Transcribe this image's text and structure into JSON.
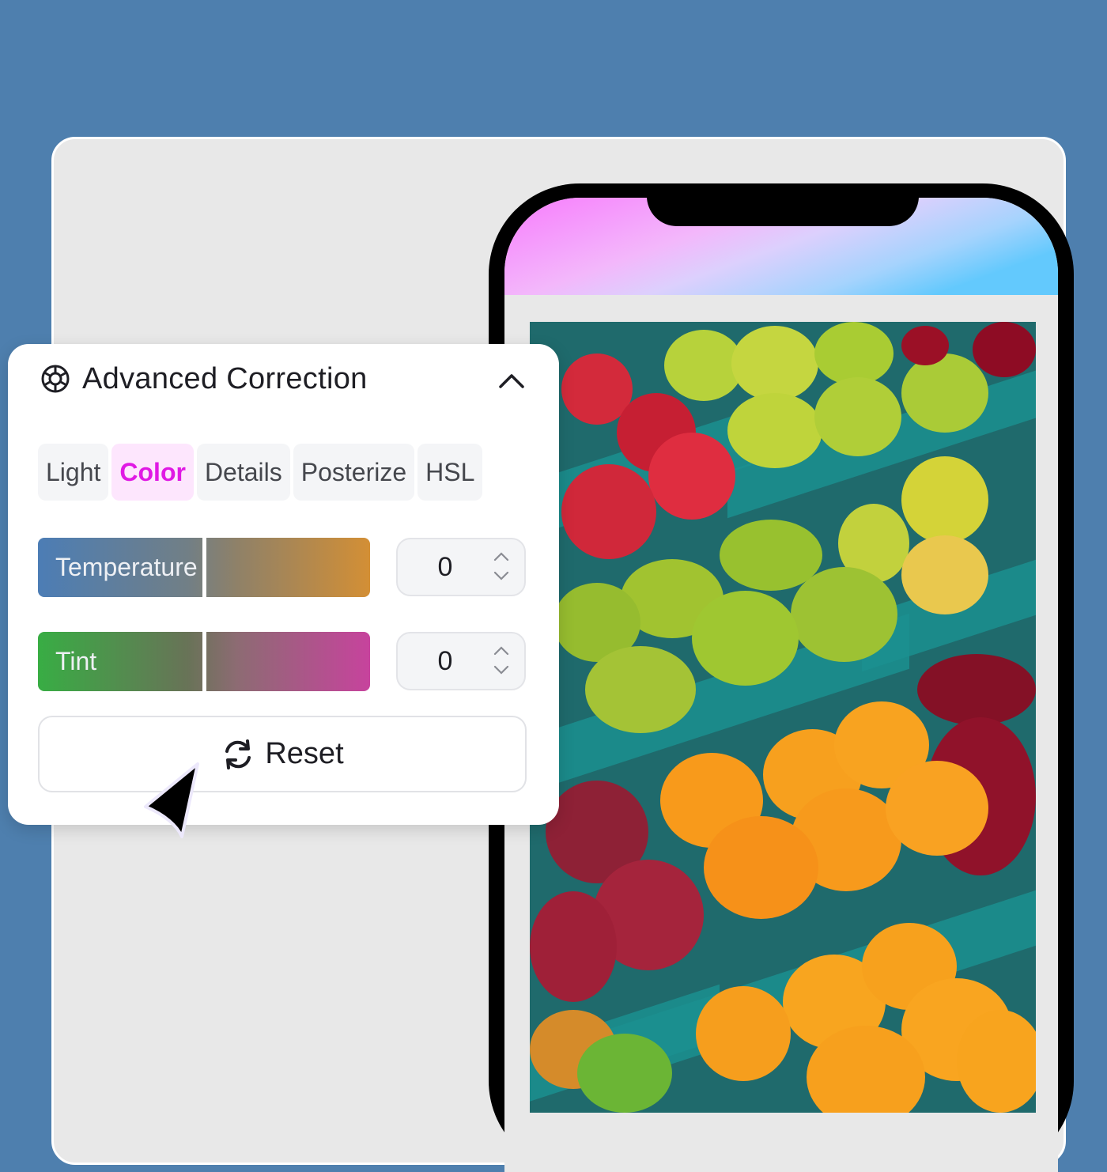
{
  "panel": {
    "title": "Advanced Correction",
    "icon": "aperture-icon",
    "collapse_icon": "chevron-up-icon",
    "tabs": [
      {
        "label": "Light",
        "active": false
      },
      {
        "label": "Color",
        "active": true
      },
      {
        "label": "Details",
        "active": false
      },
      {
        "label": "Posterize",
        "active": false
      },
      {
        "label": "HSL",
        "active": false
      }
    ],
    "sliders": [
      {
        "label": "Temperature",
        "value": "0",
        "position_fraction": 0.5,
        "gradient_from": "#4c7db5",
        "gradient_to": "#d38f35"
      },
      {
        "label": "Tint",
        "value": "0",
        "position_fraction": 0.5,
        "gradient_from": "#38ad44",
        "gradient_to": "#c7439d"
      }
    ],
    "reset_label": "Reset",
    "reset_icon": "refresh-icon"
  },
  "colors": {
    "background": "#4e7fae",
    "accent": "#e019e4",
    "accent_bg": "#fde6fd"
  },
  "phone": {
    "image_subject": "fruit market crates (strawberries, apples, kiwis, oranges, cherries)"
  }
}
